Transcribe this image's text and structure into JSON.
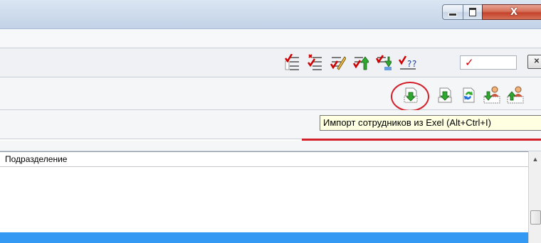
{
  "window": {
    "buttons": [
      "minimize",
      "maximize",
      "close"
    ],
    "close_glyph": "X"
  },
  "toolbar_top": {
    "icons": [
      "checklist-check-icon",
      "checklist-cross-icon",
      "checklist-pencil-icon",
      "checklist-arrow-up-icon",
      "checklist-arrow-down-icon",
      "checklist-question-icon"
    ],
    "filter_value": "✓",
    "close_panel_glyph": "✕"
  },
  "toolbar_second": {
    "icons": [
      "import-excel-icon",
      "export-excel-icon",
      "refresh-icon",
      "import-user-icon",
      "export-user-icon"
    ],
    "tooltip": "Импорт сотрудников из Exel  (Alt+Ctrl+I)"
  },
  "grid": {
    "columns": [
      "Подразделение"
    ],
    "selected_row_color": "#3399f3"
  },
  "scrollbar": {
    "up_arrow": "▲"
  },
  "colors": {
    "annotation_red": "#d4202a",
    "tooltip_bg": "#ffffe1",
    "check_red": "#d10000",
    "arrow_green": "#2fa82f"
  }
}
